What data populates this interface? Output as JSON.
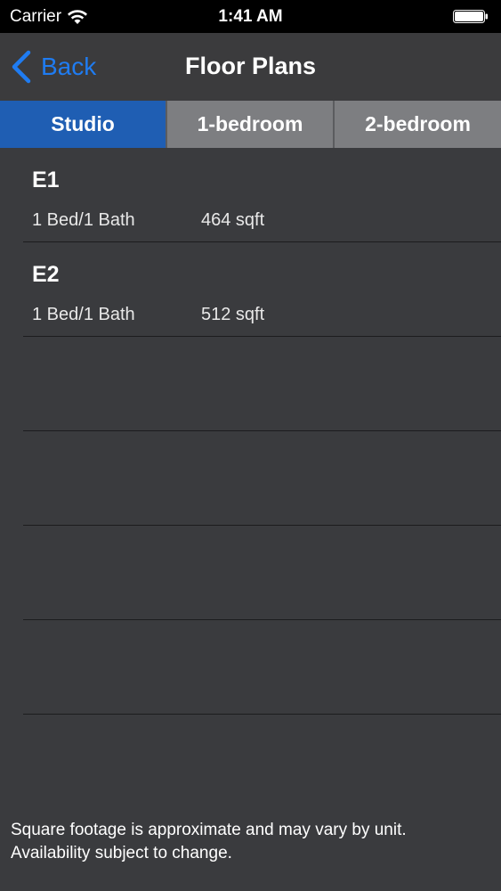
{
  "status_bar": {
    "carrier": "Carrier",
    "time": "1:41 AM",
    "wifi_icon": "wifi-icon",
    "battery_icon": "battery-full-icon"
  },
  "nav": {
    "back_label": "Back",
    "title": "Floor Plans",
    "accent_color": "#1f7cf2"
  },
  "tabs": [
    {
      "label": "Studio",
      "selected": true
    },
    {
      "label": "1-bedroom",
      "selected": false
    },
    {
      "label": "2-bedroom",
      "selected": false
    }
  ],
  "plans": [
    {
      "name": "E1",
      "beds": "1 Bed/1 Bath",
      "sqft": "464 sqft"
    },
    {
      "name": "E2",
      "beds": "1 Bed/1 Bath",
      "sqft": "512 sqft"
    }
  ],
  "footer": {
    "line1": "Square footage is approximate and may vary by unit.",
    "line2": "Availability subject to change."
  },
  "colors": {
    "selected_tab": "#1f5eb3",
    "unselected_tab": "#7d7e81",
    "background": "#3a3b3e"
  }
}
